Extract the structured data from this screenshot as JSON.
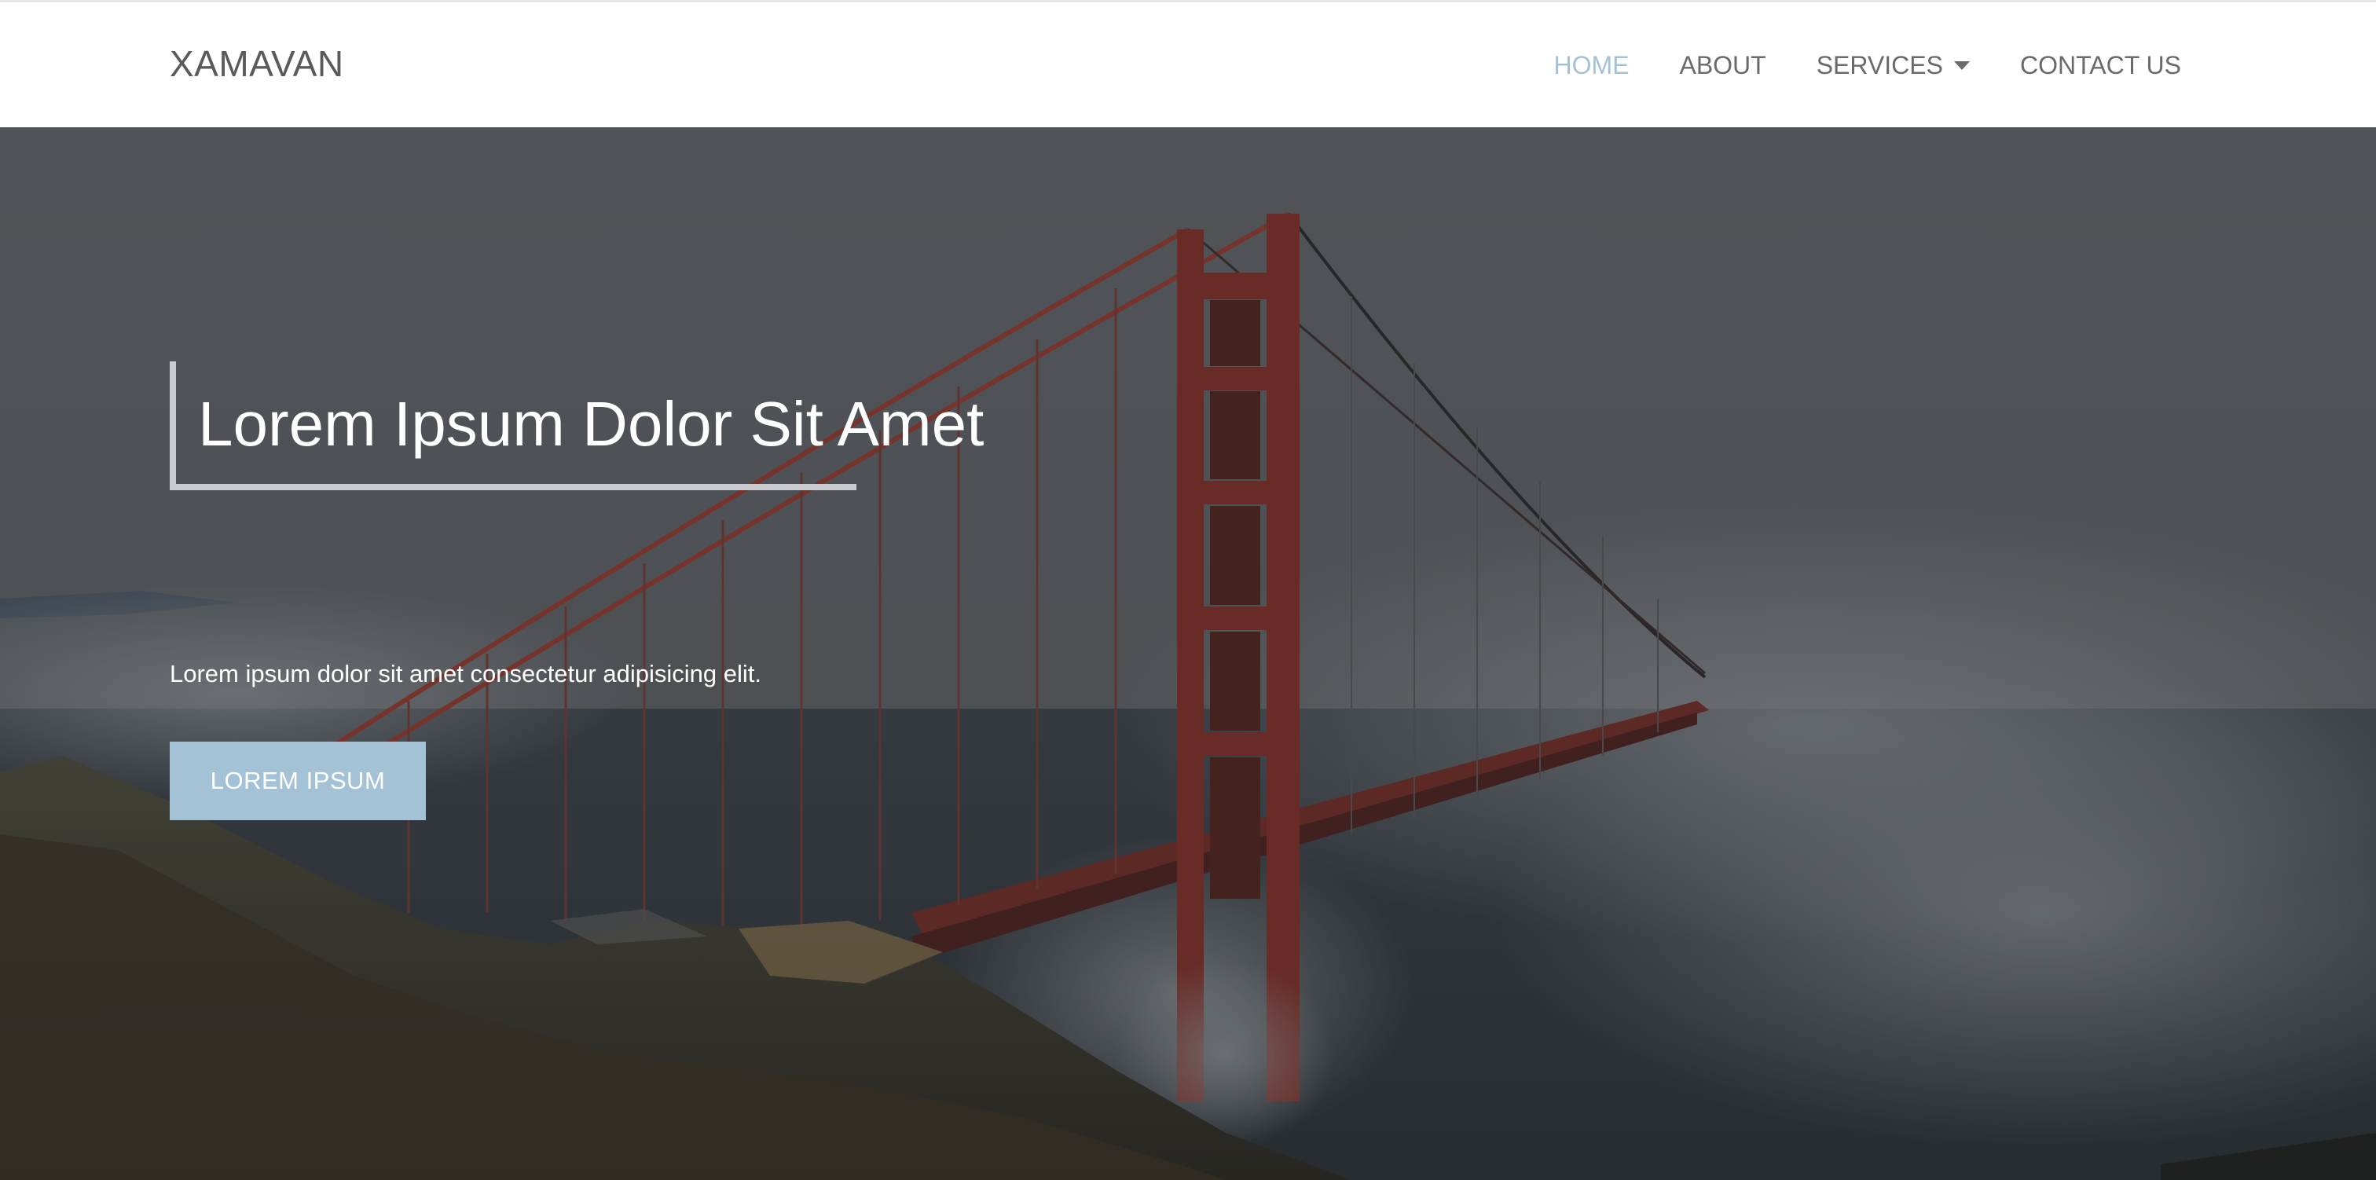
{
  "brand": {
    "name": "XAMAVAN"
  },
  "nav": {
    "items": [
      {
        "label": "HOME",
        "active": true
      },
      {
        "label": "ABOUT"
      },
      {
        "label": "SERVICES",
        "has_dropdown": true
      },
      {
        "label": "CONTACT US"
      }
    ]
  },
  "hero": {
    "title": "Lorem Ipsum Dolor Sit Amet",
    "subtitle": "Lorem ipsum dolor sit amet consectetur adipisicing elit.",
    "button_label": "LOREM IPSUM",
    "image_subject": "suspension bridge in fog over coastal cliffs"
  },
  "colors": {
    "accent": "#a3c2d6",
    "nav_text": "#6a6a6a",
    "brand_text": "#5a5a5a",
    "bridge": "#8a3a30"
  }
}
